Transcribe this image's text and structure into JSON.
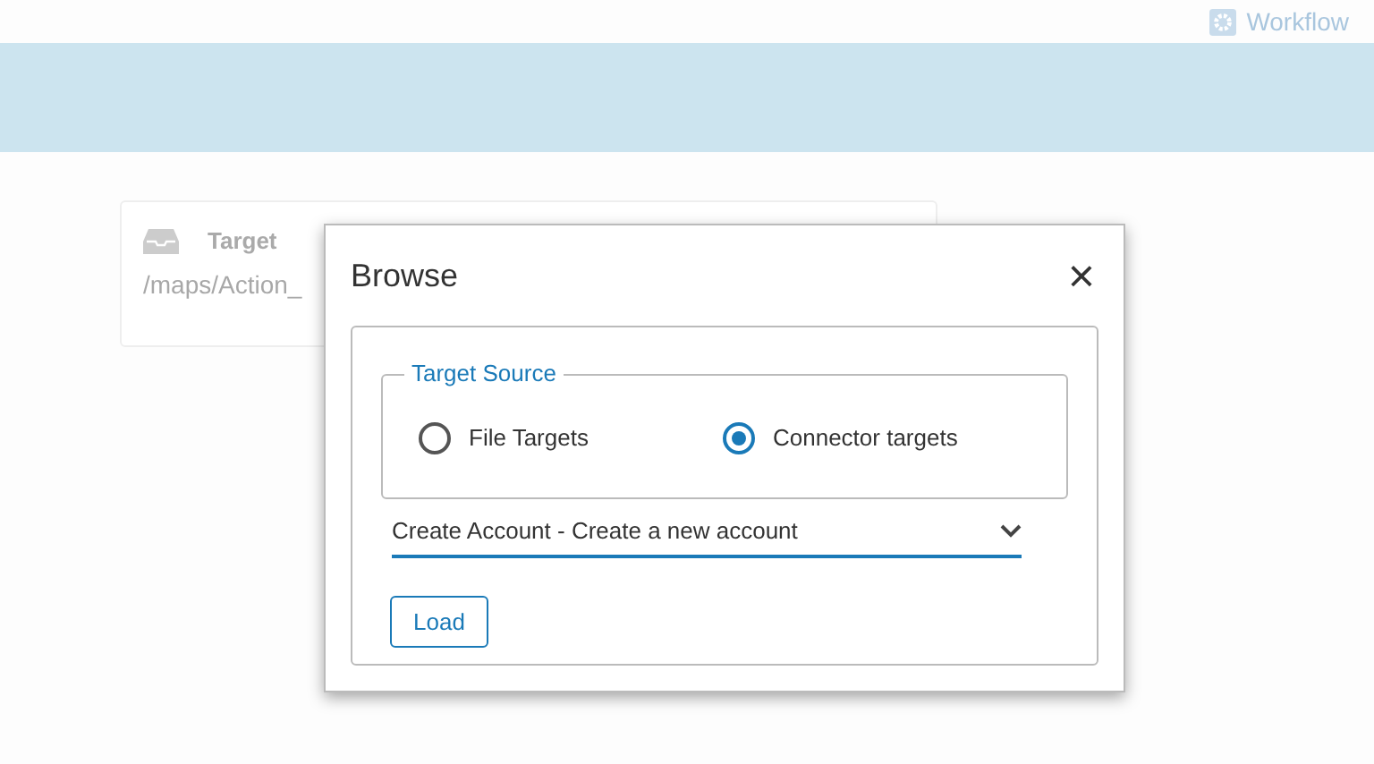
{
  "header": {
    "link": "Workflow"
  },
  "target_card": {
    "title": "Target",
    "path": "/maps/Action_"
  },
  "dialog": {
    "title": "Browse",
    "close": "×",
    "fieldset": {
      "legend": "Target Source",
      "options": [
        {
          "label": "File Targets",
          "selected": false
        },
        {
          "label": "Connector targets",
          "selected": true
        }
      ]
    },
    "select": {
      "value": "Create Account - Create a new account"
    },
    "button": "Load"
  }
}
